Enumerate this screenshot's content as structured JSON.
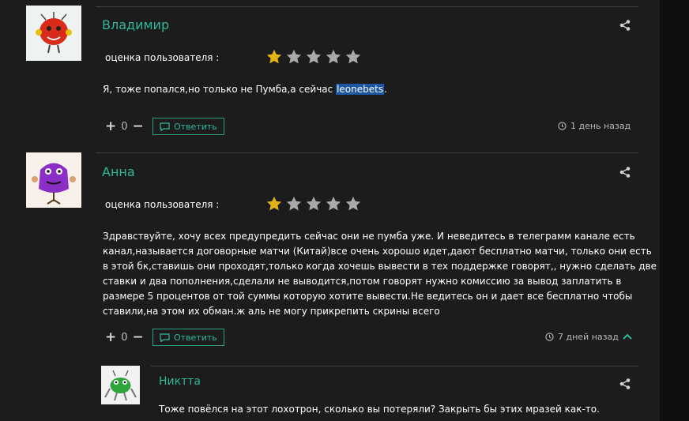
{
  "comments": [
    {
      "author": "Владимир",
      "rating_label": "оценка пользователя :",
      "rating": 1,
      "rating_max": 5,
      "text_before": "Я, тоже попался,но только не Пумба,а сейчас ",
      "text_highlight": "leonebets",
      "text_after": ".",
      "votes": "0",
      "reply_label": "Ответить",
      "time": "1 день назад"
    },
    {
      "author": "Анна",
      "rating_label": "оценка пользователя :",
      "rating": 1,
      "rating_max": 5,
      "text_lines": [
        "Здравствуйте, хочу всех предупредить сейчас они не пумба уже. И неведитесь в телеграмм канале есть",
        "канал,называется договорные матчи (Китай)все очень хорошо идет,дают бесплатно матчи, только они есть",
        "в этой бк,ставишь они проходят,только когда хочешь вывести в тех поддержке говорят,, нужно сделать две",
        "ставки и два пополнения,сделали не выводится,потом говорят нужно комиссию за вывод заплатить в",
        "размере 5 процентов от той суммы которую хотите вывести.Не ведитесь он и дает все бесплатно чтобы",
        "ставили,на этом их обман.ж аль не могу прикрепить скрины всего"
      ],
      "votes": "0",
      "reply_label": "Ответить",
      "time": "7 дней назад"
    }
  ],
  "reply": {
    "author": "Никтта",
    "text": "Тоже повёлся на этот лохотрон, сколько вы потеряли? Закрыть бы этих мразей как-то."
  },
  "colors": {
    "accent": "#2fb89a",
    "star_filled": "#e2b416",
    "star_empty": "#a9a9a9",
    "highlight": "#1d57a4"
  }
}
